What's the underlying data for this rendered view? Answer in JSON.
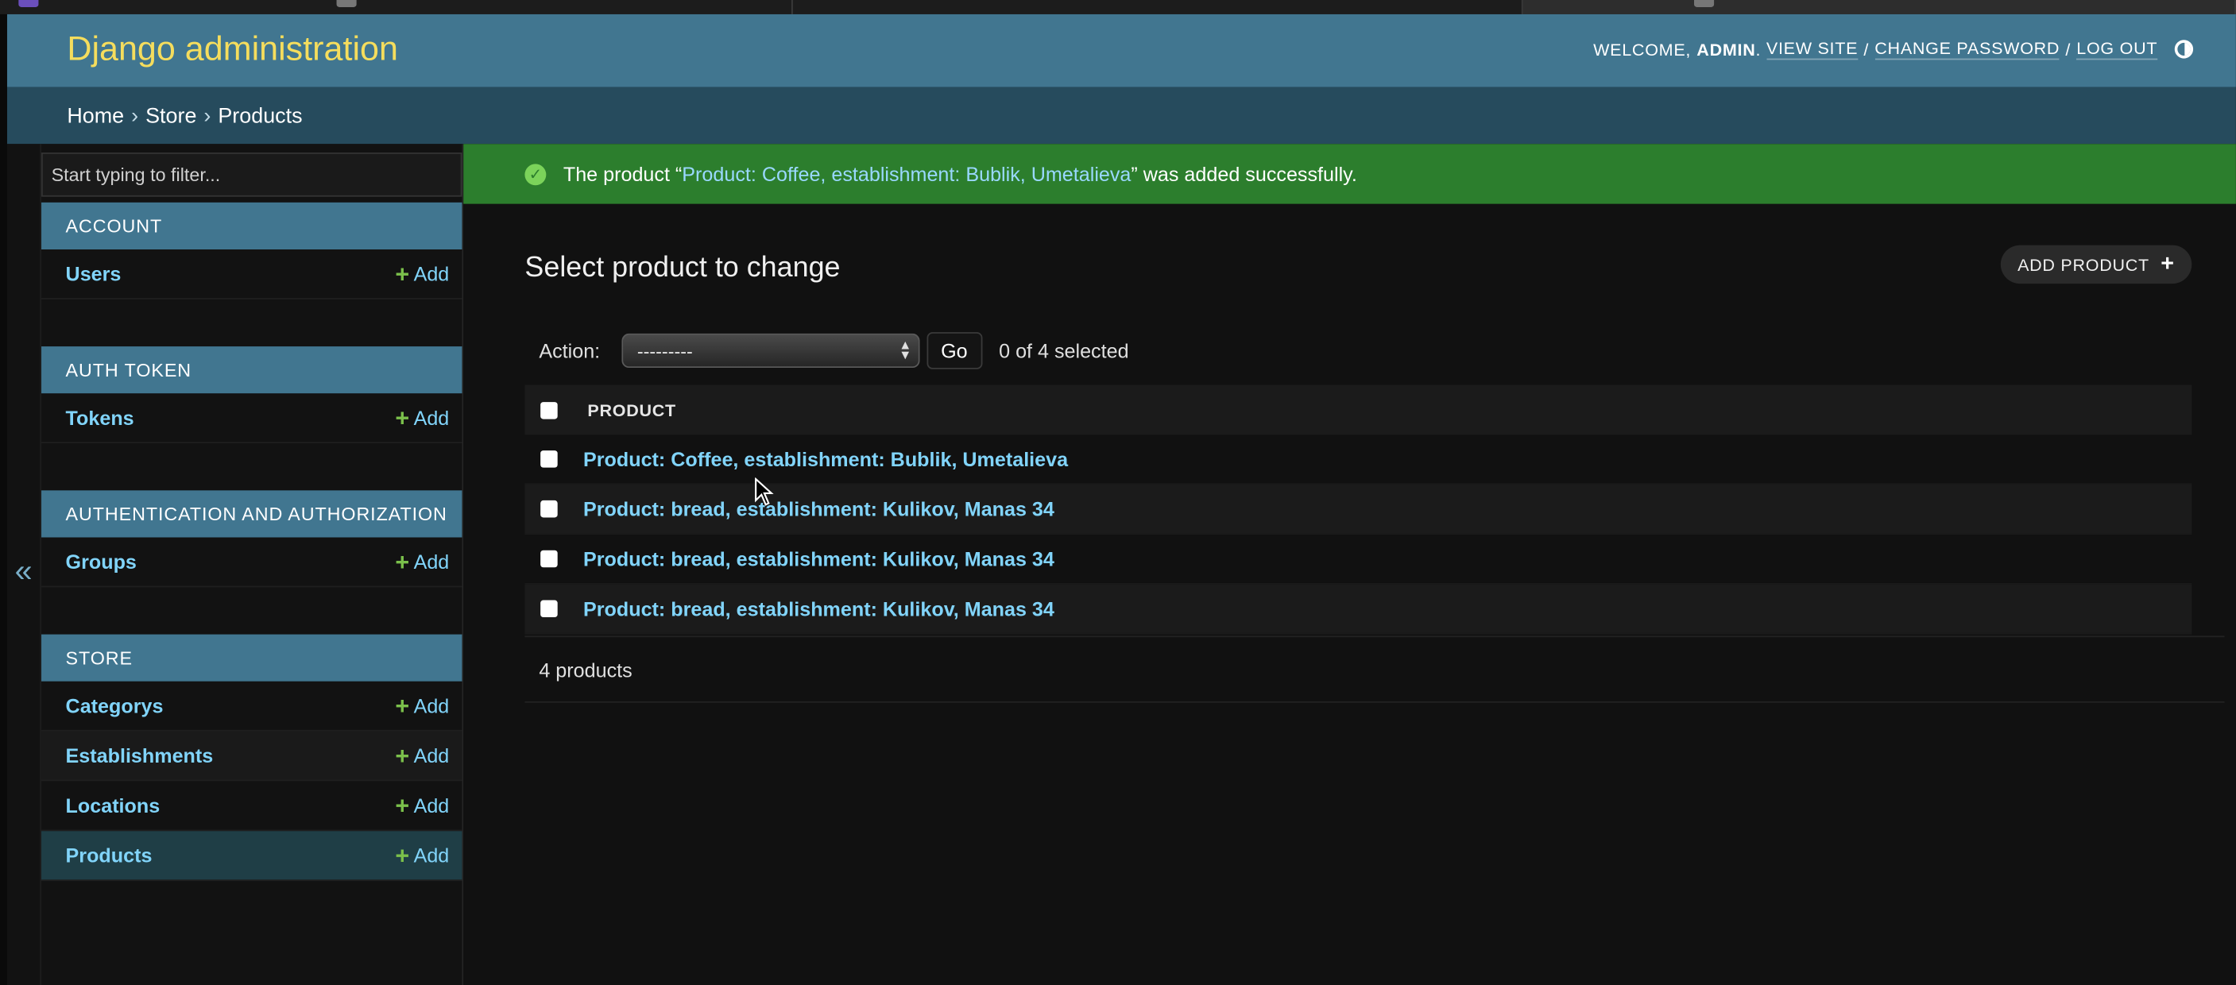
{
  "header": {
    "site_name": "Django administration",
    "welcome": "WELCOME,",
    "username": "ADMIN",
    "view_site": "VIEW SITE",
    "change_password": "CHANGE PASSWORD",
    "log_out": "LOG OUT",
    "separator": "/",
    "theme_icon": "theme-toggle-icon"
  },
  "breadcrumbs": {
    "items": [
      "Home",
      "Store"
    ],
    "current": "Products",
    "separator": "›"
  },
  "sidebar": {
    "filter_placeholder": "Start typing to filter...",
    "toggle_glyph": "«",
    "add_label": "Add",
    "plus_glyph": "+",
    "modules": [
      {
        "caption": "ACCOUNT",
        "models": [
          {
            "name": "Users"
          }
        ]
      },
      {
        "caption": "AUTH TOKEN",
        "models": [
          {
            "name": "Tokens"
          }
        ]
      },
      {
        "caption": "AUTHENTICATION AND AUTHORIZATION",
        "models": [
          {
            "name": "Groups"
          }
        ]
      },
      {
        "caption": "STORE",
        "models": [
          {
            "name": "Categorys"
          },
          {
            "name": "Establishments"
          },
          {
            "name": "Locations"
          },
          {
            "name": "Products",
            "current": true
          }
        ]
      }
    ]
  },
  "message": {
    "icon": "check-circle-icon",
    "prefix": "The product “",
    "link": "Product: Coffee, establishment: Bublik, Umetalieva",
    "suffix": "” was added successfully."
  },
  "content": {
    "title": "Select product to change",
    "add_button": "ADD PRODUCT",
    "action_label": "Action:",
    "action_value": "---------",
    "go_label": "Go",
    "selected_counter": "0 of 4 selected",
    "column_header": "PRODUCT",
    "rows": [
      "Product: Coffee, establishment: Bublik, Umetalieva",
      "Product: bread, establishment: Kulikov, Manas 34",
      "Product: bread, establishment: Kulikov, Manas 34",
      "Product: bread, establishment: Kulikov, Manas 34"
    ],
    "result_count": "4 products"
  },
  "colors": {
    "header_bg": "#417690",
    "breadcrumbs_bg": "#264b5d",
    "site_name": "#f5dd5d",
    "link": "#81d4fa",
    "success_bg": "#2c7e2d",
    "add_plus": "#7bc04b"
  }
}
